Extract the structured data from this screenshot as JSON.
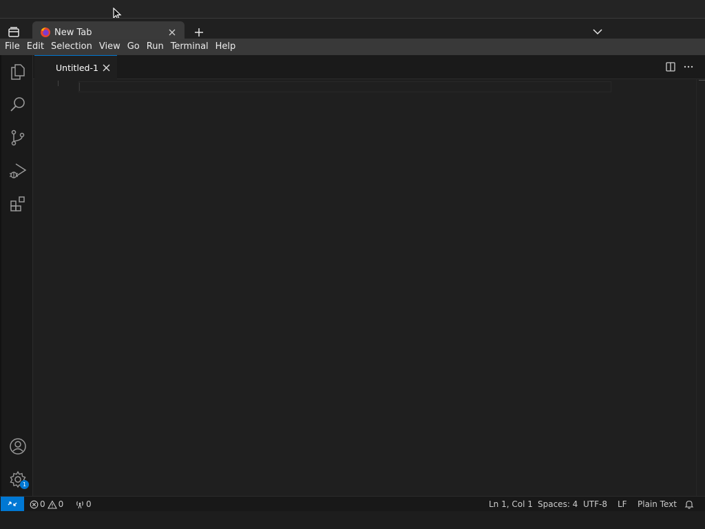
{
  "browser": {
    "tab_title": "New Tab"
  },
  "menubar": {
    "items": [
      "File",
      "Edit",
      "Selection",
      "View",
      "Go",
      "Run",
      "Terminal",
      "Help"
    ]
  },
  "activitybar": {
    "icons": [
      "explorer-icon",
      "search-icon",
      "source-control-icon",
      "run-debug-icon",
      "extensions-icon"
    ],
    "bottom_icons": [
      "accounts-icon",
      "manage-gear-icon"
    ],
    "settings_badge": "1"
  },
  "editor": {
    "tab_label": "Untitled-1"
  },
  "statusbar": {
    "errors": "0",
    "warnings": "0",
    "ports": "0",
    "cursor_position": "Ln 1, Col 1",
    "indentation": "Spaces: 4",
    "encoding": "UTF-8",
    "eol": "LF",
    "language": "Plain Text"
  },
  "colors": {
    "accent": "#0078d4",
    "editor_bg": "#1f1f1f",
    "menubar_bg": "#393939"
  }
}
